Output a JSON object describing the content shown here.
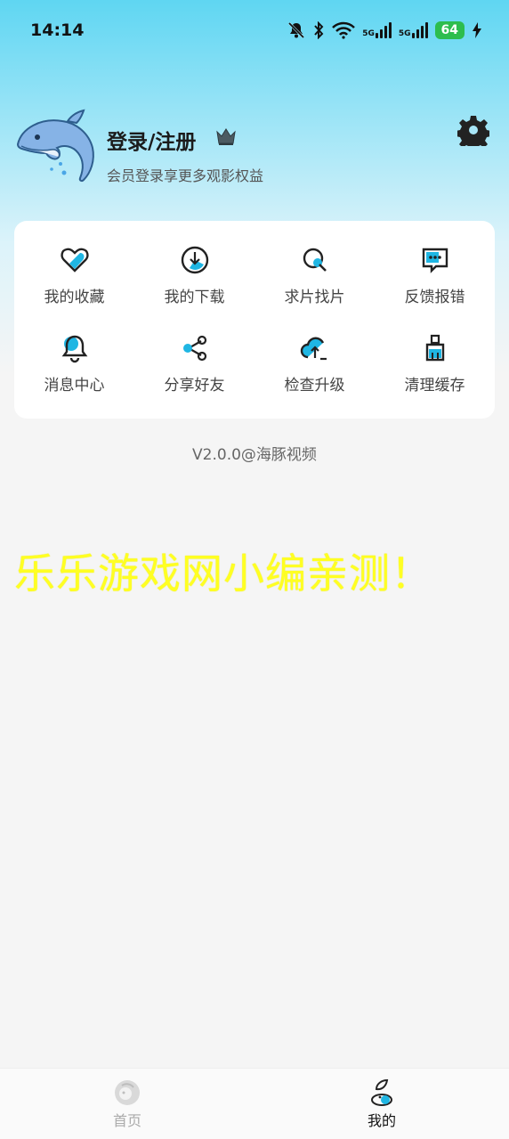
{
  "status_bar": {
    "time": "14:14",
    "battery": "64",
    "network_1": "5G",
    "network_2": "5G",
    "icons": [
      "bell-off-icon",
      "bluetooth-icon",
      "wifi-icon",
      "signal-icon",
      "signal-icon",
      "battery-icon",
      "charging-icon"
    ]
  },
  "profile": {
    "title": "登录/注册",
    "subtitle": "会员登录享更多观影权益",
    "avatar_icon": "dolphin-avatar",
    "badge_icon": "crown-icon",
    "settings_icon": "gear-icon"
  },
  "grid": {
    "items": [
      {
        "label": "我的收藏",
        "icon": "heart-icon"
      },
      {
        "label": "我的下载",
        "icon": "download-icon"
      },
      {
        "label": "求片找片",
        "icon": "search-icon"
      },
      {
        "label": "反馈报错",
        "icon": "feedback-icon"
      },
      {
        "label": "消息中心",
        "icon": "bell-icon"
      },
      {
        "label": "分享好友",
        "icon": "share-icon"
      },
      {
        "label": "检查升级",
        "icon": "cloud-upload-icon"
      },
      {
        "label": "清理缓存",
        "icon": "broom-icon"
      }
    ]
  },
  "version": "V2.0.0@海豚视频",
  "watermark": "乐乐游戏网小编亲测！",
  "tab_bar": {
    "tabs": [
      {
        "label": "首页",
        "icon": "home-icon",
        "active": false
      },
      {
        "label": "我的",
        "icon": "profile-icon",
        "active": true
      }
    ]
  },
  "colors": {
    "accent": "#1fb6e3",
    "header_top": "#5fd6f2",
    "watermark": "#ffff22",
    "battery": "#2dbd4e"
  }
}
